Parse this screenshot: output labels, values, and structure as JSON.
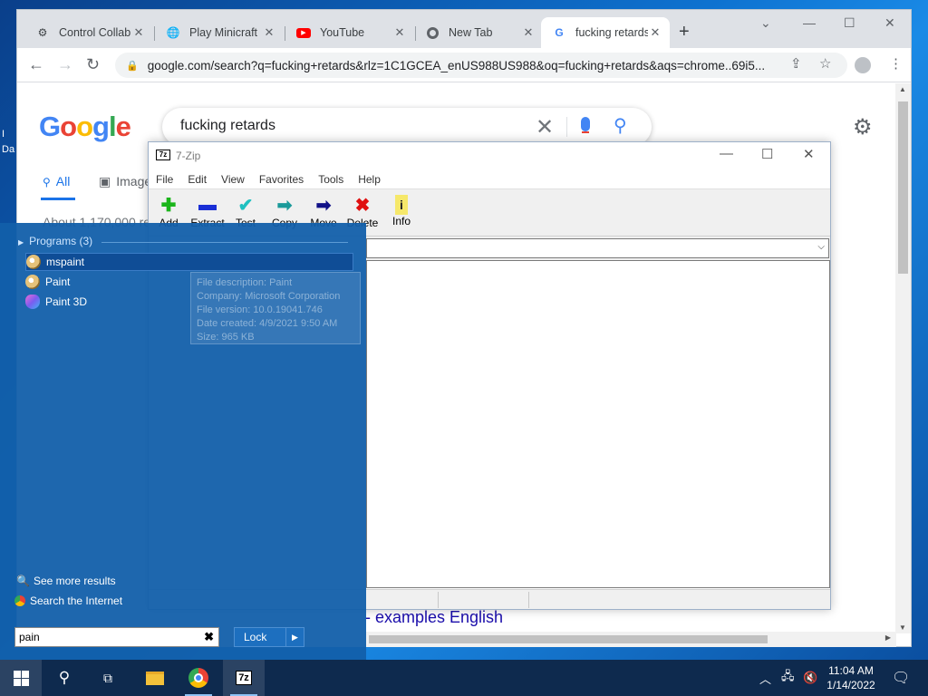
{
  "desktop": {
    "fragment": "Da"
  },
  "browser": {
    "tabs": [
      {
        "label": "Control Collab",
        "icon": "collab-icon"
      },
      {
        "label": "Play Minicraft",
        "icon": "globe-icon"
      },
      {
        "label": "YouTube",
        "icon": "youtube-icon"
      },
      {
        "label": "New Tab",
        "icon": "chrome-icon"
      },
      {
        "label": "fucking retards",
        "icon": "google-icon",
        "active": true
      }
    ],
    "url": "google.com/search?q=fucking+retards&rlz=1C1GCEA_enUS988US988&oq=fucking+retards&aqs=chrome..69i5..."
  },
  "google": {
    "logo": "Google",
    "query": "fucking retards",
    "tab_all": "All",
    "tab_images": "Image",
    "result_count": "About 1,170,000 re",
    "result_link": "- examples English"
  },
  "zip": {
    "title": "7-Zip",
    "menu": [
      "File",
      "Edit",
      "View",
      "Favorites",
      "Tools",
      "Help"
    ],
    "tools": [
      {
        "label": "Add",
        "glyph": "✚",
        "color": "#1bb51b"
      },
      {
        "label": "Extract",
        "glyph": "▬",
        "color": "#1a2fd6"
      },
      {
        "label": "Test",
        "glyph": "✔",
        "color": "#1fc0c0"
      },
      {
        "label": "Copy",
        "glyph": "➡",
        "color": "#1a9a9a"
      },
      {
        "label": "Move",
        "glyph": "➡",
        "color": "#111188"
      },
      {
        "label": "Delete",
        "glyph": "✖",
        "color": "#e01010"
      },
      {
        "label": "Info",
        "glyph": "ℹ",
        "color": "#202020"
      }
    ]
  },
  "start_menu": {
    "header": "Programs (3)",
    "programs": [
      "mspaint",
      "Paint",
      "Paint 3D"
    ],
    "tooltip": {
      "description": "File description: Paint",
      "company": "Company: Microsoft Corporation",
      "version": "File version: 10.0.19041.746",
      "created": "Date created: 4/9/2021 9:50 AM",
      "size": "Size: 965 KB"
    },
    "see_more": "See more results",
    "search_internet": "Search the Internet",
    "search_value": "pain",
    "lock_label": "Lock"
  },
  "taskbar": {
    "time": "11:04 AM",
    "date": "1/14/2022"
  },
  "colors": {
    "accent": "#1a73e8",
    "start_bg": "#125faa",
    "taskbar": "#0e2a4e"
  }
}
